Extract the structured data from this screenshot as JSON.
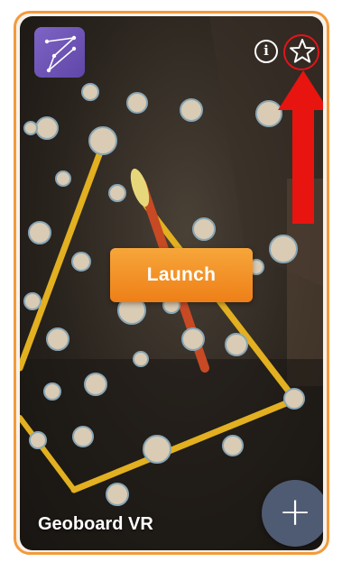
{
  "card": {
    "title": "Geoboard VR",
    "launch_label": "Launch",
    "add_label": "+",
    "info_label": "i",
    "icons": {
      "app": "geoboard-app-icon",
      "info": "info-icon",
      "favorite": "star-icon",
      "add": "plus-icon"
    },
    "colors": {
      "accent": "#f39a3c",
      "launch": "#ef7f18",
      "app_icon": "#6a52b6",
      "add_button": "#4f5b72",
      "highlight": "#e2141a"
    }
  },
  "annotation": {
    "type": "highlight-circle-with-arrow",
    "target": "favorite-star-button"
  }
}
